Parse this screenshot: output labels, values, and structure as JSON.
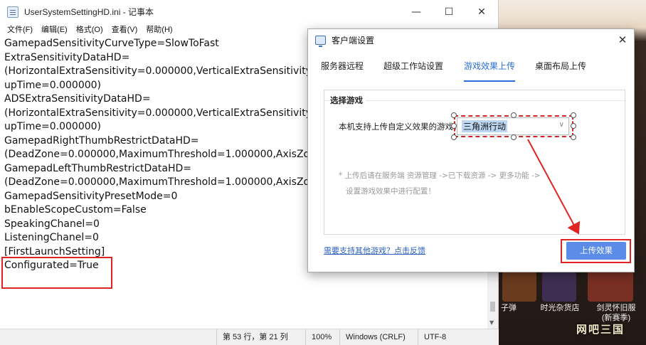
{
  "notepad": {
    "title": "UserSystemSettingHD.ini - 记事本",
    "menu": [
      "文件(F)",
      "编辑(E)",
      "格式(O)",
      "查看(V)",
      "帮助(H)"
    ],
    "lines": [
      "GamepadSensitivityCurveType=SlowToFast",
      "ExtraSensitivityDataHD=",
      "(HorizontalExtraSensitivity=0.000000,VerticalExtraSensitivity=",
      "upTime=0.000000)",
      "ADSExtraSensitivityDataHD=",
      "(HorizontalExtraSensitivity=0.000000,VerticalExtraSensitivity=",
      "upTime=0.000000)",
      "GamepadRightThumbRestrictDataHD=",
      "(DeadZone=0.000000,MaximumThreshold=1.000000,AxisZon",
      "GamepadLeftThumbRestrictDataHD=",
      "(DeadZone=0.000000,MaximumThreshold=1.000000,AxisZon",
      "GamepadSensitivityPresetMode=0",
      "bEnableScopeCustom=False",
      "SpeakingChanel=0",
      "ListeningChanel=0",
      "",
      "[FirstLaunchSetting]",
      "Configurated=True"
    ],
    "status": {
      "position": "第 53 行，第 21 列",
      "zoom": "100%",
      "line_ending": "Windows (CRLF)",
      "encoding": "UTF-8"
    }
  },
  "dialog": {
    "title": "客户端设置",
    "tabs": [
      "服务器远程",
      "超级工作站设置",
      "游戏效果上传",
      "桌面布局上传"
    ],
    "active_tab": 2,
    "group_title": "选择游戏",
    "game_label": "本机支持上传自定义效果的游戏：",
    "game_selected": "三角洲行动",
    "note_line1": "* 上传后请在服务端 资源管理 ->已下载资源 -> 更多功能 ->",
    "note_line2": "设置游戏效果中进行配置！",
    "feedback_link": "需要支持其他游戏？点击反馈",
    "upload_button": "上传效果"
  },
  "background": {
    "labels": [
      "子弹",
      "时光杂货店",
      "剑灵怀旧服",
      "(新赛季)"
    ],
    "watermark": "网吧三国"
  },
  "colors": {
    "accent": "#2b6fd6",
    "button": "#5b8de8",
    "annotation_red": "#e02424"
  }
}
